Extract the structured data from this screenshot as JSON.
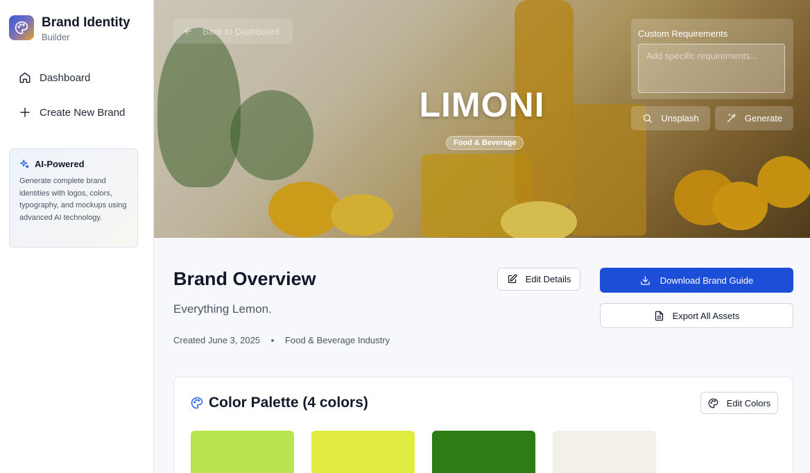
{
  "sidebar": {
    "brand_title": "Brand Identity",
    "brand_subtitle": "Builder",
    "nav": [
      {
        "label": "Dashboard",
        "icon": "home-icon"
      },
      {
        "label": "Create New Brand",
        "icon": "plus-icon"
      }
    ],
    "ai_card": {
      "title": "AI-Powered",
      "body": "Generate complete brand identities with logos, colors, typography, and mockups using advanced AI technology."
    }
  },
  "hero": {
    "back_label": "Back to Dashboard",
    "brand_name": "LIMONI",
    "industry_badge": "Food & Beverage",
    "custom_requirements_label": "Custom Requirements",
    "custom_requirements_placeholder": "Add specific requirements...",
    "unsplash_label": "Unsplash",
    "generate_label": "Generate"
  },
  "overview": {
    "title": "Brand Overview",
    "tagline": "Everything Lemon.",
    "created": "Created June 3, 2025",
    "industry": "Food & Beverage Industry",
    "edit_details_label": "Edit Details",
    "download_label": "Download Brand Guide",
    "export_label": "Export All Assets"
  },
  "palette": {
    "title": "Color Palette (4 colors)",
    "edit_label": "Edit Colors",
    "colors": [
      "#b8e550",
      "#e0ec40",
      "#2e7d14",
      "#f3f0ea"
    ]
  }
}
